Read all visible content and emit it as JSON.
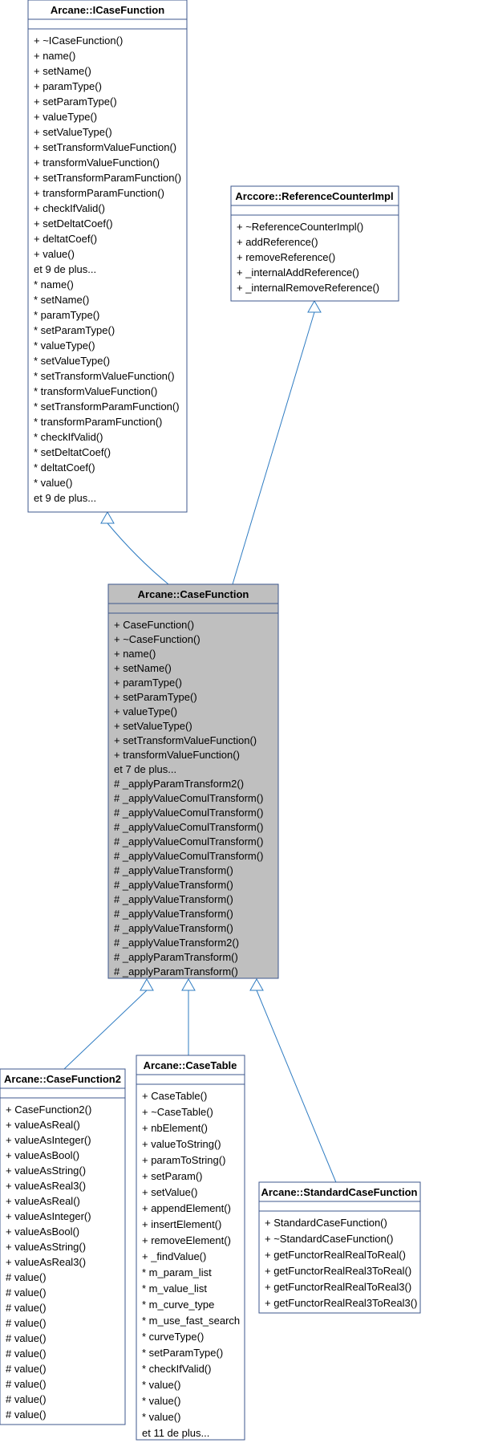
{
  "classes": {
    "icf": {
      "title": "Arcane::ICaseFunction",
      "members": [
        "+  ~ICaseFunction()",
        "+  name()",
        "+  setName()",
        "+  paramType()",
        "+  setParamType()",
        "+  valueType()",
        "+  setValueType()",
        "+  setTransformValueFunction()",
        "+  transformValueFunction()",
        "+  setTransformParamFunction()",
        "+  transformParamFunction()",
        "+  checkIfValid()",
        "+  setDeltatCoef()",
        "+  deltatCoef()",
        "+  value()",
        "    et 9 de plus...",
        "*  name()",
        "*  setName()",
        "*  paramType()",
        "*  setParamType()",
        "*  valueType()",
        "*  setValueType()",
        "*  setTransformValueFunction()",
        "*  transformValueFunction()",
        "*  setTransformParamFunction()",
        "*  transformParamFunction()",
        "*  checkIfValid()",
        "*  setDeltatCoef()",
        "*  deltatCoef()",
        "*  value()",
        "    et 9 de plus..."
      ]
    },
    "rci": {
      "title": "Arccore::ReferenceCounterImpl",
      "members": [
        "+  ~ReferenceCounterImpl()",
        "+  addReference()",
        "+  removeReference()",
        "+  _internalAddReference()",
        "+  _internalRemoveReference()"
      ]
    },
    "cf": {
      "title": "Arcane::CaseFunction",
      "members": [
        "+  CaseFunction()",
        "+  ~CaseFunction()",
        "+  name()",
        "+  setName()",
        "+  paramType()",
        "+  setParamType()",
        "+  valueType()",
        "+  setValueType()",
        "+  setTransformValueFunction()",
        "+  transformValueFunction()",
        "    et 7 de plus...",
        "#  _applyParamTransform2()",
        "#  _applyValueComulTransform()",
        "#  _applyValueComulTransform()",
        "#  _applyValueComulTransform()",
        "#  _applyValueComulTransform()",
        "#  _applyValueComulTransform()",
        "#  _applyValueTransform()",
        "#  _applyValueTransform()",
        "#  _applyValueTransform()",
        "#  _applyValueTransform()",
        "#  _applyValueTransform()",
        "#  _applyValueTransform2()",
        "#  _applyParamTransform()",
        "#  _applyParamTransform()"
      ]
    },
    "cf2": {
      "title": "Arcane::CaseFunction2",
      "members": [
        "+   CaseFunction2()",
        "+   valueAsReal()",
        "+   valueAsInteger()",
        "+   valueAsBool()",
        "+   valueAsString()",
        "+   valueAsReal3()",
        "+   valueAsReal()",
        "+   valueAsInteger()",
        "+   valueAsBool()",
        "+   valueAsString()",
        "+   valueAsReal3()",
        "#   value()",
        "#   value()",
        "#   value()",
        "#   value()",
        "#   value()",
        "#   value()",
        "#   value()",
        "#   value()",
        "#   value()",
        "#   value()"
      ]
    },
    "ct": {
      "title": "Arcane::CaseTable",
      "members": [
        "+  CaseTable()",
        "+  ~CaseTable()",
        "+  nbElement()",
        "+  valueToString()",
        "+  paramToString()",
        "+  setParam()",
        "+  setValue()",
        "+  appendElement()",
        "+  insertElement()",
        "+  removeElement()",
        "+  _findValue()",
        "*  m_param_list",
        "*  m_value_list",
        "*  m_curve_type",
        "*  m_use_fast_search",
        "*  curveType()",
        "*  setParamType()",
        "*  checkIfValid()",
        "*  value()",
        "*  value()",
        "*  value()",
        "    et 11 de plus..."
      ]
    },
    "scf": {
      "title": "Arcane::StandardCaseFunction",
      "members": [
        "+  StandardCaseFunction()",
        "+  ~StandardCaseFunction()",
        "+  getFunctorRealRealToReal()",
        "+  getFunctorRealReal3ToReal()",
        "+  getFunctorRealRealToReal3()",
        "+  getFunctorRealReal3ToReal3()"
      ]
    }
  }
}
